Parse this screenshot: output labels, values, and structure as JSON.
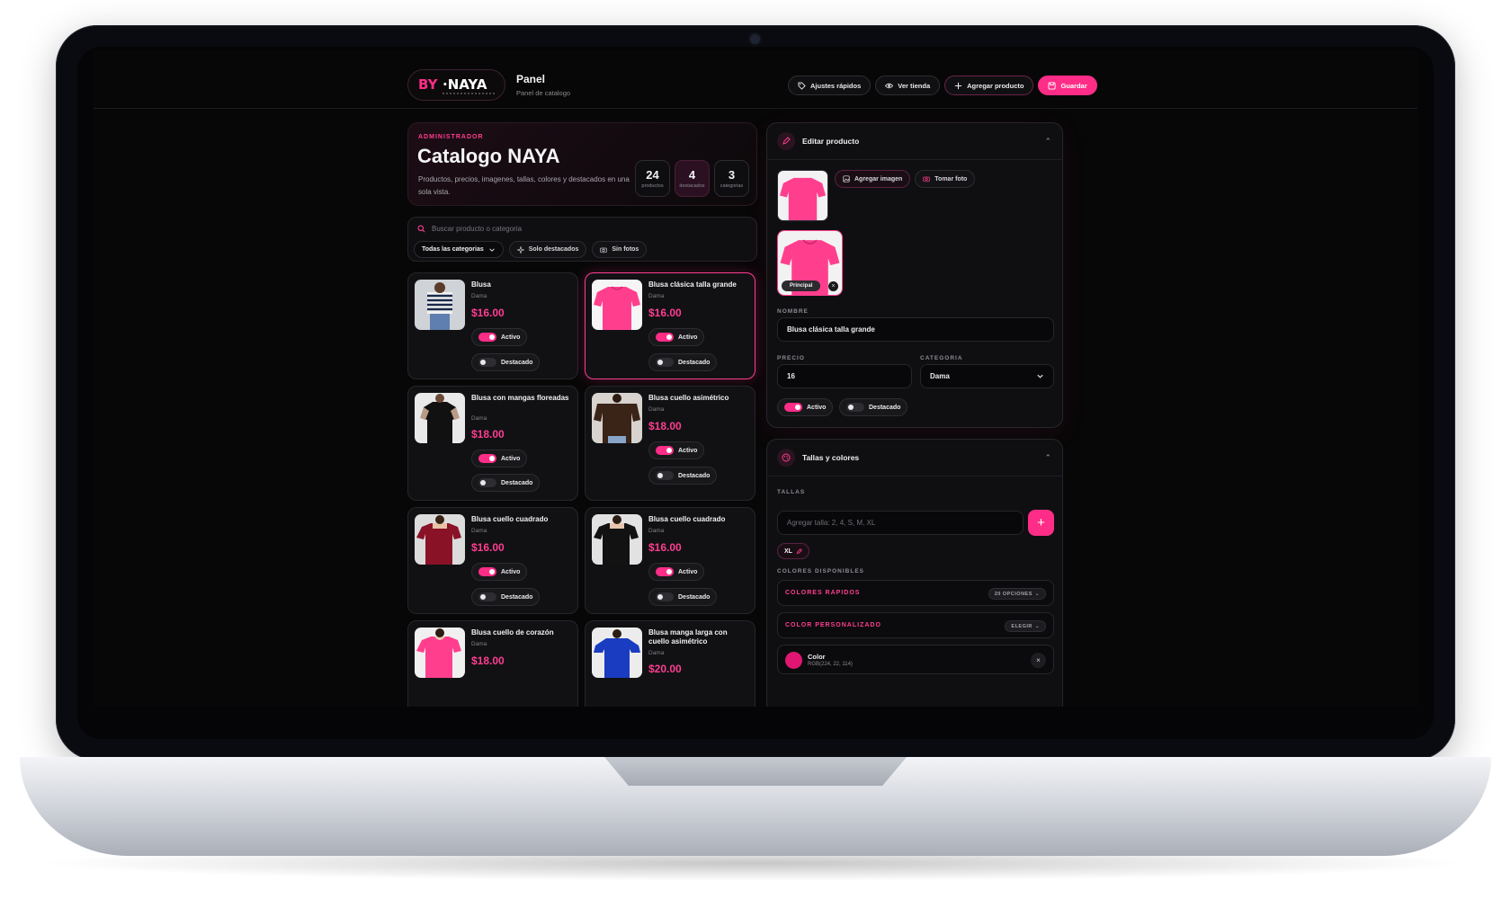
{
  "header": {
    "brand_title": "Panel",
    "brand_subtitle": "Panel de catalogo",
    "actions": {
      "quick_settings": "Ajustes rápidos",
      "view_store": "Ver tienda",
      "add_product": "Agregar producto",
      "save": "Guardar"
    }
  },
  "hero": {
    "eyebrow": "ADMINISTRADOR",
    "title": "Catalogo NAYA",
    "description": "Productos, precios, imagenes, tallas, colores y destacados en una sola vista.",
    "stats": [
      {
        "value": "24",
        "label": "productos"
      },
      {
        "value": "4",
        "label": "destacados"
      },
      {
        "value": "3",
        "label": "categorias"
      }
    ]
  },
  "filters": {
    "search_placeholder": "Buscar producto o categoria",
    "category_select": "Todas las categorias",
    "only_featured": "Solo destacados",
    "no_photos": "Sin fotos"
  },
  "labels": {
    "active": "Activo",
    "featured": "Destacado"
  },
  "products": [
    {
      "name": "Blusa",
      "category": "Dama",
      "price": "$16.00",
      "active": true,
      "featured": false
    },
    {
      "name": "Blusa clásica talla grande",
      "category": "Dama",
      "price": "$16.00",
      "active": true,
      "featured": false
    },
    {
      "name": "Blusa con mangas floreadas",
      "category": "Dama",
      "price": "$18.00",
      "active": true,
      "featured": false
    },
    {
      "name": "Blusa cuello asimétrico",
      "category": "Dama",
      "price": "$18.00",
      "active": true,
      "featured": false
    },
    {
      "name": "Blusa cuello cuadrado",
      "category": "Dama",
      "price": "$16.00",
      "active": true,
      "featured": false
    },
    {
      "name": "Blusa cuello cuadrado",
      "category": "Dama",
      "price": "$16.00",
      "active": true,
      "featured": false
    },
    {
      "name": "Blusa cuello de corazón",
      "category": "Dama",
      "price": "$18.00"
    },
    {
      "name": "Blusa manga larga con cuello asimétrico",
      "category": "Dama",
      "price": "$20.00"
    }
  ],
  "colors": {
    "pink": "#ff2d87",
    "background": "#070707",
    "selected_color": "#e01672"
  },
  "editor": {
    "title": "Editar producto",
    "add_image": "Agregar imagen",
    "take_photo": "Tomar foto",
    "principal_badge": "Principal",
    "name_label": "NOMBRE",
    "name_value": "Blusa clásica talla grande",
    "price_label": "PRECIO",
    "price_value": "16",
    "category_label": "CATEGORIA",
    "category_value": "Dama",
    "active_label": "Activo",
    "featured_label": "Destacado"
  },
  "sizes_colors": {
    "title": "Tallas y colores",
    "sizes_label": "TALLAS",
    "size_placeholder": "Agregar talla: 2, 4, S, M, XL",
    "sizes": [
      "XL"
    ],
    "available_colors_label": "COLORES DISPONIBLES",
    "quick_colors": "COLORES RAPIDOS",
    "quick_colors_badge": "20 OPCIONES",
    "custom_color": "COLOR PERSONALIZADO",
    "custom_color_badge": "ELEGIR",
    "color_name": "Color",
    "color_rgb": "RGB(224, 22, 114)"
  }
}
